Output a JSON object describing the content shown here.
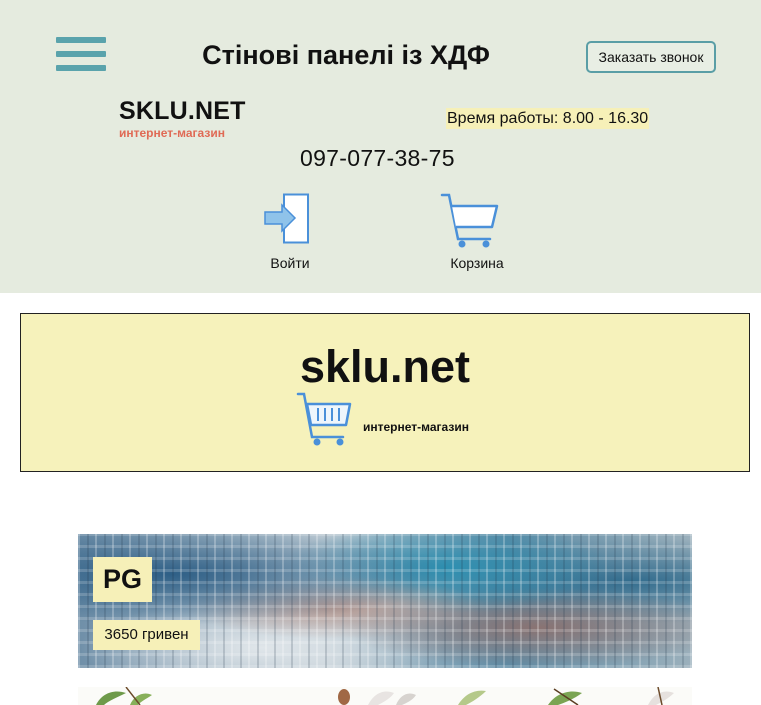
{
  "header": {
    "title": "Стінові панелі із ХДФ",
    "callback_label": "Заказать звонок",
    "logo": {
      "name": "SKLU.NET",
      "tagline": "интернет-магазин"
    },
    "hours": "Время работы: 8.00 - 16.30",
    "phone": "097-077-38-75",
    "login_label": "Войти",
    "cart_label": "Корзина",
    "icons": [
      "menu-icon",
      "login-icon",
      "cart-icon"
    ]
  },
  "banner": {
    "title": "sklu.net",
    "subtitle": "интернет-магазин",
    "icon": "cart-icon"
  },
  "products": [
    {
      "name": "PG",
      "price": "3650 гривен"
    }
  ],
  "colors": {
    "header_bg": "#e5ebdf",
    "accent": "#5aa3ac",
    "banner_bg": "#f6f2bb",
    "label_bg": "#f6f0b8",
    "logo_tagline": "#e06a55",
    "icon_blue": "#4a90d9"
  }
}
